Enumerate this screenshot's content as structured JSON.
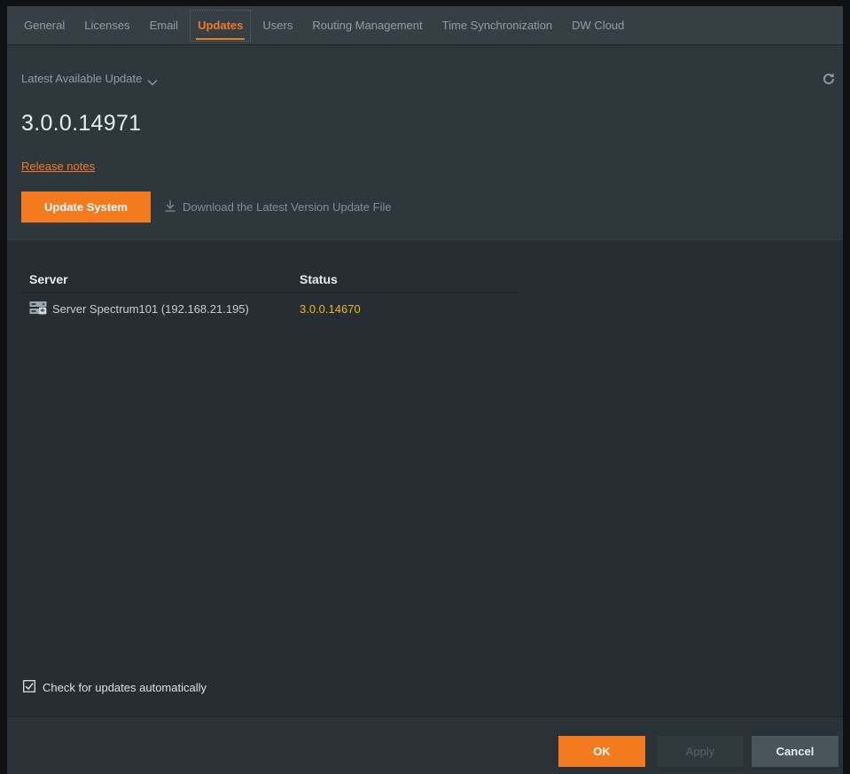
{
  "tabs": [
    {
      "label": "General",
      "active": false
    },
    {
      "label": "Licenses",
      "active": false
    },
    {
      "label": "Email",
      "active": false
    },
    {
      "label": "Updates",
      "active": true
    },
    {
      "label": "Users",
      "active": false
    },
    {
      "label": "Routing Management",
      "active": false
    },
    {
      "label": "Time Synchronization",
      "active": false
    },
    {
      "label": "DW Cloud",
      "active": false
    }
  ],
  "update": {
    "dropdown_label": "Latest Available Update",
    "version": "3.0.0.14971",
    "release_notes": "Release notes",
    "update_button": "Update System",
    "download_link": "Download the Latest Version Update File"
  },
  "table": {
    "headers": {
      "server": "Server",
      "status": "Status"
    },
    "rows": [
      {
        "server": "Server Spectrum101 (192.168.21.195)",
        "status": "3.0.0.14670"
      }
    ]
  },
  "auto_check": {
    "label": "Check for updates automatically",
    "checked": true
  },
  "footer": {
    "ok": "OK",
    "apply": "Apply",
    "cancel": "Cancel"
  },
  "colors": {
    "accent": "#f37a1f",
    "status": "#f0b51a",
    "background": "#262e33"
  },
  "icons": {
    "dropdown": "chevron-down-icon",
    "refresh": "refresh-icon",
    "download": "download-icon",
    "server": "server-icon",
    "checkbox": "checkbox-checked-icon"
  }
}
